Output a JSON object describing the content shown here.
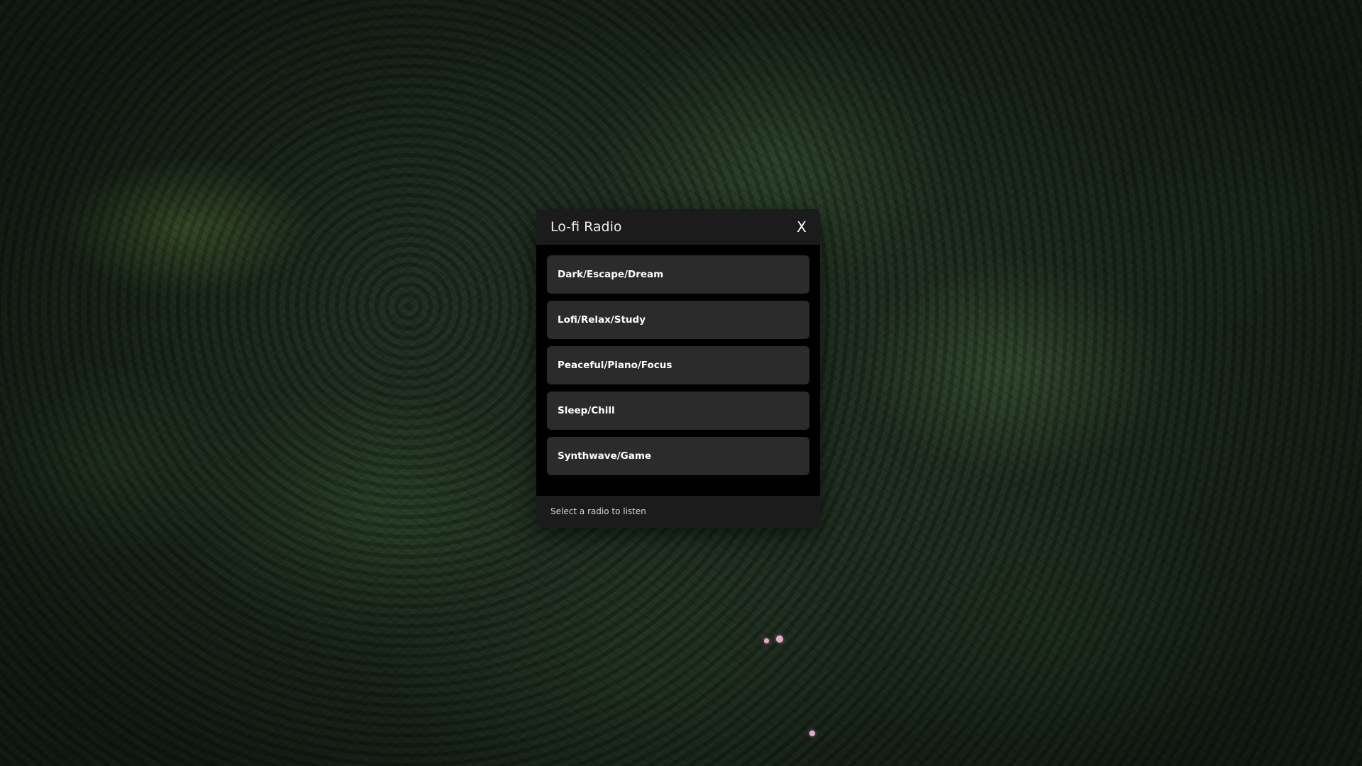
{
  "window": {
    "title": "Lo-fi Radio",
    "close_label": "X"
  },
  "stations": [
    {
      "label": "Dark/Escape/Dream"
    },
    {
      "label": "Lofi/Relax/Study"
    },
    {
      "label": "Peaceful/Piano/Focus"
    },
    {
      "label": "Sleep/Chill"
    },
    {
      "label": "Synthwave/Game"
    }
  ],
  "status": {
    "text": "Select a radio to listen"
  },
  "colors": {
    "window_background": "#000000",
    "title_bar": "#1b1b1b",
    "button_background": "#2b2b2b",
    "text": "#ffffff"
  }
}
